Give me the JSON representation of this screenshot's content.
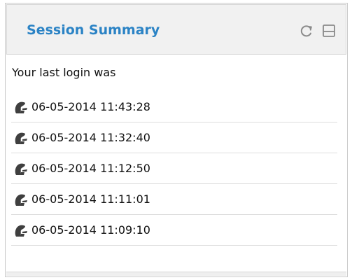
{
  "panel": {
    "title": "Session Summary",
    "intro": "Your last login was",
    "icons": {
      "refresh": "refresh-icon",
      "minimize": "minimize-icon",
      "entry": "login-history-icon"
    },
    "logins": [
      {
        "datetime": "06-05-2014 11:43:28"
      },
      {
        "datetime": "06-05-2014 11:32:40"
      },
      {
        "datetime": "06-05-2014 11:12:50"
      },
      {
        "datetime": "06-05-2014 11:11:01"
      },
      {
        "datetime": "06-05-2014 11:09:10"
      }
    ]
  },
  "colors": {
    "title": "#2b83c5",
    "header_background": "#f1f1f1",
    "border": "#c9c9c9",
    "text": "#111111",
    "icon": "#3f3f3f",
    "row_divider": "#dddddd"
  }
}
